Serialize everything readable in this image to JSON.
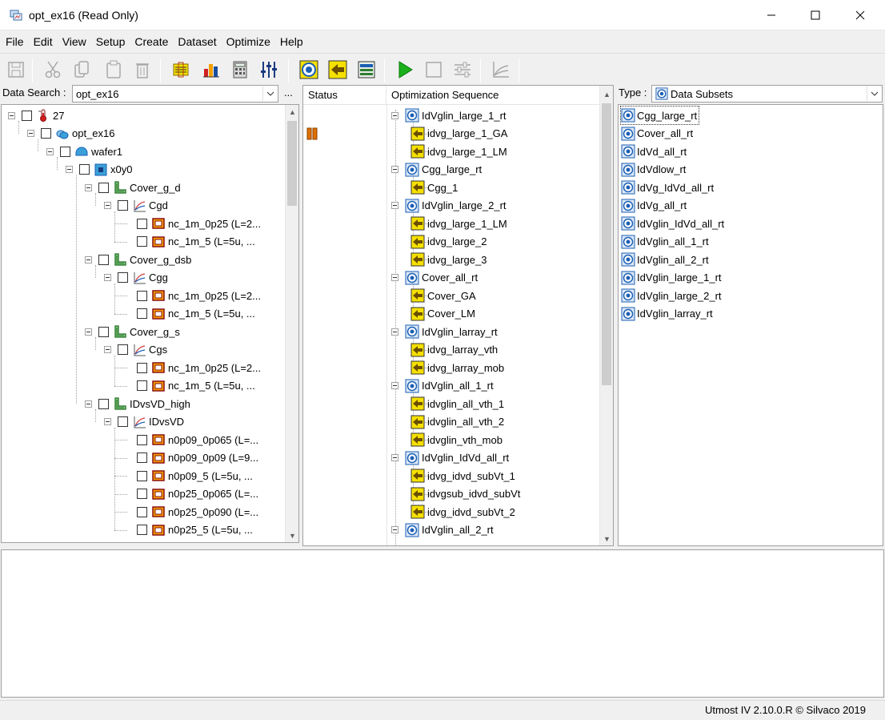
{
  "window": {
    "title": "opt_ex16 (Read Only)"
  },
  "menu": [
    "File",
    "Edit",
    "View",
    "Setup",
    "Create",
    "Dataset",
    "Optimize",
    "Help"
  ],
  "toolbar": {
    "icons": [
      "save-icon",
      "cut-icon",
      "copy-icon",
      "paste-icon",
      "delete-icon",
      "data-sort-icon",
      "bar-chart-icon",
      "calculator-icon",
      "sliders-icon",
      "target-icon",
      "arrow-left-icon",
      "export-icon",
      "run-icon",
      "stop-icon",
      "settings-icon",
      "plot-icon"
    ]
  },
  "data_search": {
    "label": "Data Search :",
    "value": "opt_ex16",
    "more": "..."
  },
  "data_tree": [
    {
      "label": "27",
      "icon": "temperature-icon",
      "level": 0
    },
    {
      "label": "opt_ex16",
      "icon": "project-icon",
      "level": 1
    },
    {
      "label": "wafer1",
      "icon": "wafer-icon",
      "level": 2
    },
    {
      "label": "x0y0",
      "icon": "die-icon",
      "level": 3
    },
    {
      "label": "Cover_g_d",
      "icon": "folder-icon",
      "level": 4
    },
    {
      "label": "Cgd",
      "icon": "curve-icon",
      "level": 5
    },
    {
      "label": "nc_1m_0p25 (L=2...",
      "icon": "device-icon",
      "level": 6
    },
    {
      "label": "nc_1m_5 (L=5u, ...",
      "icon": "device-icon",
      "level": 6
    },
    {
      "label": "Cover_g_dsb",
      "icon": "folder-icon",
      "level": 4
    },
    {
      "label": "Cgg",
      "icon": "curve-icon",
      "level": 5
    },
    {
      "label": "nc_1m_0p25 (L=2...",
      "icon": "device-icon",
      "level": 6
    },
    {
      "label": "nc_1m_5 (L=5u, ...",
      "icon": "device-icon",
      "level": 6
    },
    {
      "label": "Cover_g_s",
      "icon": "folder-icon",
      "level": 4
    },
    {
      "label": "Cgs",
      "icon": "curve-icon",
      "level": 5
    },
    {
      "label": "nc_1m_0p25 (L=2...",
      "icon": "device-icon",
      "level": 6
    },
    {
      "label": "nc_1m_5 (L=5u, ...",
      "icon": "device-icon",
      "level": 6
    },
    {
      "label": "IDvsVD_high",
      "icon": "folder-icon",
      "level": 4
    },
    {
      "label": "IDvsVD",
      "icon": "curve-icon",
      "level": 5
    },
    {
      "label": "n0p09_0p065 (L=...",
      "icon": "device-icon",
      "level": 6
    },
    {
      "label": "n0p09_0p09 (L=9...",
      "icon": "device-icon",
      "level": 6
    },
    {
      "label": "n0p09_5 (L=5u, ...",
      "icon": "device-icon",
      "level": 6
    },
    {
      "label": "n0p25_0p065 (L=...",
      "icon": "device-icon",
      "level": 6
    },
    {
      "label": "n0p25_0p090 (L=...",
      "icon": "device-icon",
      "level": 6
    },
    {
      "label": "n0p25_5 (L=5u, ...",
      "icon": "device-icon",
      "level": 6
    }
  ],
  "status_header": "Status",
  "sequence_header": "Optimization Sequence",
  "sequence": [
    {
      "label": "IdVglin_large_1_rt",
      "icon": "target-icon",
      "level": 0
    },
    {
      "label": "idvg_large_1_GA",
      "icon": "step-icon",
      "level": 1
    },
    {
      "label": "idvg_large_1_LM",
      "icon": "step-icon",
      "level": 1
    },
    {
      "label": "Cgg_large_rt",
      "icon": "target-icon",
      "level": 0
    },
    {
      "label": "Cgg_1",
      "icon": "step-icon",
      "level": 1
    },
    {
      "label": "IdVglin_large_2_rt",
      "icon": "target-icon",
      "level": 0
    },
    {
      "label": "idvg_large_1_LM",
      "icon": "step-icon",
      "level": 1
    },
    {
      "label": "idvg_large_2",
      "icon": "step-icon",
      "level": 1
    },
    {
      "label": "idvg_large_3",
      "icon": "step-icon",
      "level": 1
    },
    {
      "label": "Cover_all_rt",
      "icon": "target-icon",
      "level": 0
    },
    {
      "label": "Cover_GA",
      "icon": "step-icon",
      "level": 1
    },
    {
      "label": "Cover_LM",
      "icon": "step-icon",
      "level": 1
    },
    {
      "label": "IdVglin_larray_rt",
      "icon": "target-icon",
      "level": 0
    },
    {
      "label": "idvg_larray_vth",
      "icon": "step-icon",
      "level": 1
    },
    {
      "label": "idvg_larray_mob",
      "icon": "step-icon",
      "level": 1
    },
    {
      "label": "IdVglin_all_1_rt",
      "icon": "target-icon",
      "level": 0
    },
    {
      "label": "idvglin_all_vth_1",
      "icon": "step-icon",
      "level": 1
    },
    {
      "label": "idvglin_all_vth_2",
      "icon": "step-icon",
      "level": 1
    },
    {
      "label": "idvglin_vth_mob",
      "icon": "step-icon",
      "level": 1
    },
    {
      "label": "IdVglin_IdVd_all_rt",
      "icon": "target-icon",
      "level": 0
    },
    {
      "label": "idvg_idvd_subVt_1",
      "icon": "step-icon",
      "level": 1
    },
    {
      "label": "idvgsub_idvd_subVt",
      "icon": "step-icon",
      "level": 1
    },
    {
      "label": "idvg_idvd_subVt_2",
      "icon": "step-icon",
      "level": 1
    },
    {
      "label": "IdVglin_all_2_rt",
      "icon": "target-icon",
      "level": 0
    }
  ],
  "type_selector": {
    "label": "Type :",
    "value": "Data Subsets",
    "icon": "target-icon"
  },
  "subsets": [
    "Cgg_large_rt",
    "Cover_all_rt",
    "IdVd_all_rt",
    "IdVdlow_rt",
    "IdVg_IdVd_all_rt",
    "IdVg_all_rt",
    "IdVglin_IdVd_all_rt",
    "IdVglin_all_1_rt",
    "IdVglin_all_2_rt",
    "IdVglin_large_1_rt",
    "IdVglin_large_2_rt",
    "IdVglin_larray_rt"
  ],
  "status": {
    "version": "Utmost IV 2.10.0.R © Silvaco 2019"
  },
  "colors": {
    "step_icon": "#f5e000",
    "target_icon": "#1a5fb4",
    "pause_icon": "#e07000",
    "folder_icon": "#2e7d32",
    "device_icon": "#c0392b"
  }
}
